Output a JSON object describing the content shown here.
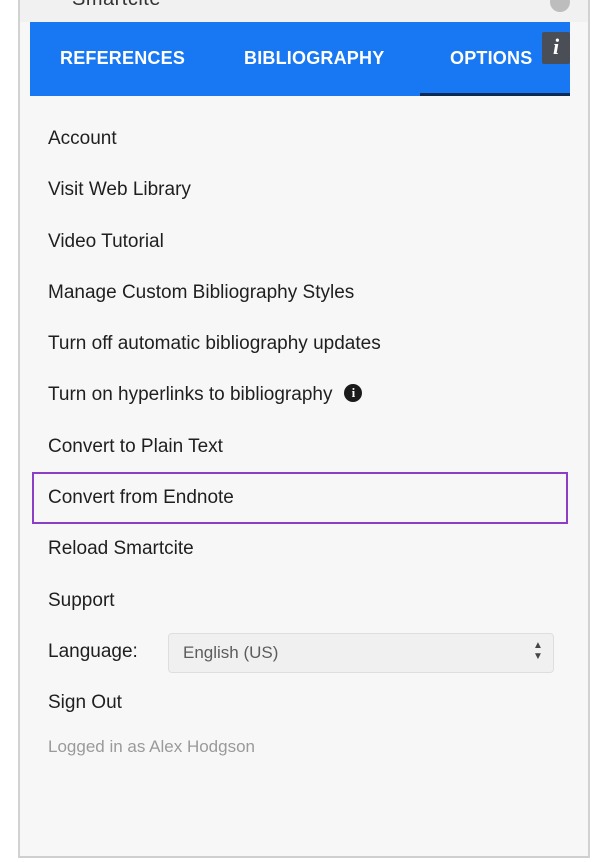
{
  "header": {
    "cut_title": "Smartcite"
  },
  "tabs": [
    {
      "label": "REFERENCES"
    },
    {
      "label": "BIBLIOGRAPHY"
    },
    {
      "label": "OPTIONS"
    }
  ],
  "info_button": {
    "glyph": "i"
  },
  "menu": {
    "items": [
      {
        "label": "Account"
      },
      {
        "label": "Visit Web Library"
      },
      {
        "label": "Video Tutorial"
      },
      {
        "label": "Manage Custom Bibliography Styles"
      },
      {
        "label": "Turn off automatic bibliography updates"
      },
      {
        "label": "Turn on hyperlinks to bibliography"
      },
      {
        "label": "Convert to Plain Text"
      },
      {
        "label": "Convert from Endnote"
      },
      {
        "label": "Reload Smartcite"
      },
      {
        "label": "Support"
      }
    ],
    "info_glyph": "i",
    "language_label": "Language:",
    "language_value": "English (US)",
    "sign_out": "Sign Out",
    "logged_in": "Logged in as Alex Hodgson"
  },
  "colors": {
    "tabbar": "#1877f2",
    "highlight": "#8b3fc7"
  }
}
